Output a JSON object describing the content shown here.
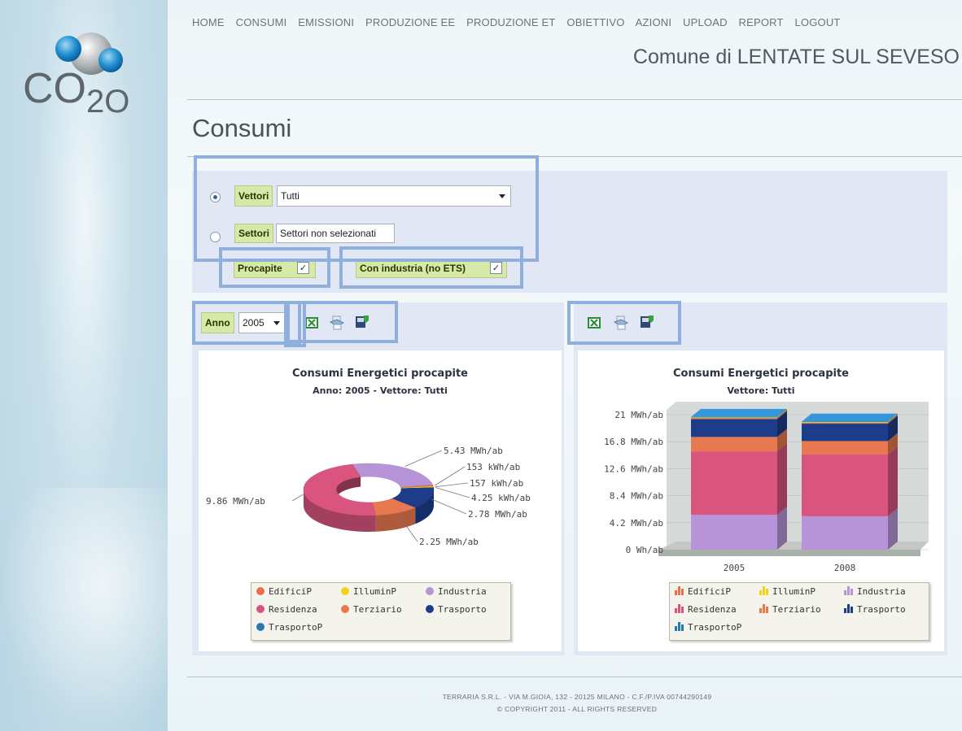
{
  "nav": [
    "HOME",
    "CONSUMI",
    "EMISSIONI",
    "PRODUZIONE EE",
    "PRODUZIONE ET",
    "OBIETTIVO",
    "AZIONI",
    "UPLOAD",
    "REPORT",
    "LOGOUT"
  ],
  "comune": "Comune di LENTATE SUL SEVESO",
  "page_title": "Consumi",
  "logo_text": "CO20",
  "filters": {
    "vettori_label": "Vettori",
    "vettori_value": "Tutti",
    "settori_label": "Settori",
    "settori_value": "Settori non selezionati",
    "procapite_label": "Procapite",
    "industria_label": "Con industria (no ETS)",
    "check_mark": "✓"
  },
  "anno": {
    "label": "Anno",
    "value": "2005"
  },
  "icons": [
    "excel-export-icon",
    "print-icon",
    "download-icon"
  ],
  "chart_left": {
    "title": "Consumi Energetici procapite",
    "subtitle": "Anno: 2005 - Vettore: Tutti",
    "labels": [
      "5.43 MWh/ab",
      "153 kWh/ab",
      "157 kWh/ab",
      "4.25 kWh/ab",
      "2.78 MWh/ab",
      "2.25 MWh/ab",
      "9.86 MWh/ab"
    ]
  },
  "chart_right": {
    "title": "Consumi Energetici procapite",
    "subtitle": "Vettore: Tutti",
    "yticks": [
      "21 MWh/ab",
      "16.8 MWh/ab",
      "12.6 MWh/ab",
      "8.4 MWh/ab",
      "4.2 MWh/ab",
      "0 Wh/ab"
    ],
    "categories": [
      "2005",
      "2008"
    ]
  },
  "legend": [
    "EdificiP",
    "IlluminP",
    "Industria",
    "Residenza",
    "Terziario",
    "Trasporto",
    "TrasportoP"
  ],
  "colors": {
    "EdificiP": "#e8704a",
    "IlluminP": "#f2d21a",
    "Industria": "#b794d8",
    "Residenza": "#d9557f",
    "Terziario": "#e8784f",
    "Trasporto": "#1d3d8a",
    "TrasportoP": "#2a78b0"
  },
  "chart_data": [
    {
      "type": "pie",
      "title": "Consumi Energetici procapite",
      "subtitle": "Anno: 2005 - Vettore: Tutti",
      "categories": [
        "Industria",
        "EdificiP",
        "IlluminP",
        "TrasportoP",
        "Trasporto",
        "Terziario",
        "Residenza"
      ],
      "values": [
        5.43,
        0.153,
        0.157,
        0.00425,
        2.78,
        2.25,
        9.86
      ],
      "unit": "MWh/ab"
    },
    {
      "type": "bar",
      "stacked": true,
      "title": "Consumi Energetici procapite",
      "subtitle": "Vettore: Tutti",
      "categories": [
        "2005",
        "2008"
      ],
      "ylim": [
        0,
        21
      ],
      "series": [
        {
          "name": "Industria",
          "values": [
            5.43,
            5.2
          ]
        },
        {
          "name": "Residenza",
          "values": [
            9.86,
            9.6
          ]
        },
        {
          "name": "Terziario",
          "values": [
            2.25,
            2.1
          ]
        },
        {
          "name": "Trasporto",
          "values": [
            2.78,
            2.7
          ]
        },
        {
          "name": "EdificiP",
          "values": [
            0.153,
            0.15
          ]
        },
        {
          "name": "IlluminP",
          "values": [
            0.157,
            0.16
          ]
        },
        {
          "name": "TrasportoP",
          "values": [
            0.00425,
            0.004
          ]
        }
      ]
    }
  ],
  "footer": {
    "line1": "TERRARIA S.R.L. - VIA M.GIOIA, 132 - 20125 MILANO - C.F./P.IVA 00744290149",
    "line2": "© COPYRIGHT 2011 - ALL RIGHTS RESERVED"
  }
}
